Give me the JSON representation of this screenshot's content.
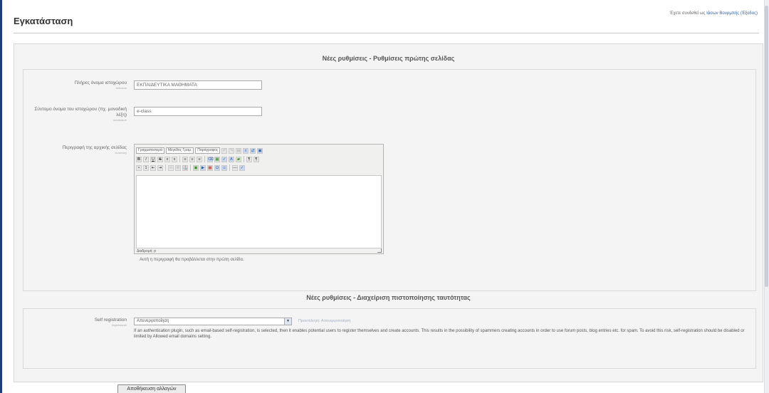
{
  "header": {
    "title": "Εγκατάσταση",
    "login_prefix": "Έχετε συνδεθεί ως",
    "login_user": "Ιάσων Βουρμπής",
    "logout": "(Έξοδος)"
  },
  "section1": {
    "heading": "Νέες ρυθμίσεις - Ρυθμίσεις πρώτης σελίδας",
    "fields": [
      {
        "label": "Πλήρες όνομα ιστοχώρου",
        "sub": "fullname",
        "value": "ΕΚΠΑΙΔΕΥΤΙΚΑ ΜΑΘΗΜΑΤΑ"
      },
      {
        "label": "Σύντομο όνομα του ιστοχώρου (πχ. μοναδική λέξη)",
        "sub": "shortname",
        "value": "e-class"
      },
      {
        "label": "Περιγραφή της αρχικής σελίδας",
        "sub": "summary",
        "value": ""
      }
    ],
    "editor": {
      "font_select": "Γραμματοσειρά",
      "size_select": "Μέγεθος Γραμ.",
      "format_select": "Παράγραφος",
      "path_label": "Διαδρομή: p"
    },
    "help": "Αυτή η περιγραφή θα προβάλλεται στην πρώτη σελίδα."
  },
  "section2": {
    "heading": "Νέες ρυθμίσεις - Διαχείριση πιστοποίησης ταυτότητας",
    "field_label": "Self registration",
    "field_sub": "registerauth",
    "select_value": "Απενεργοποίηση",
    "default_text": "Προεπιλογή: Απενεργοποίηση",
    "description": "If an authentication plugin, such as email-based self-registration, is selected, then it enables potential users to register themselves and create accounts. This results in the possibility of spammers creating accounts in order to use forum posts, blog entries etc. for spam. To avoid this risk, self-registration should be disabled or limited by Allowed email domains setting."
  },
  "footer": {
    "save_label": "Αποθήκευση αλλαγών"
  }
}
